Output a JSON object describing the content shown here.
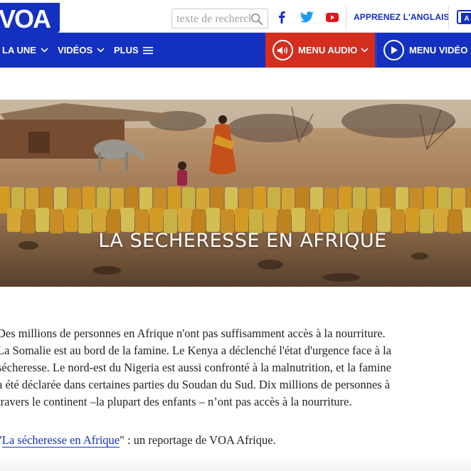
{
  "header": {
    "logo_text": "VOA",
    "search_placeholder": "texte de recherche",
    "learn_label": "APPRENEZ L'ANGLAIS"
  },
  "social": {
    "icons": [
      "facebook-icon",
      "twitter-icon",
      "youtube-icon"
    ],
    "colors": {
      "facebook": "#1330bf",
      "twitter": "#1d9bf0",
      "youtube": "#e0161b"
    }
  },
  "nav": {
    "items": [
      {
        "label": "LA UNE",
        "icon": "chevron-down-icon"
      },
      {
        "label": "VIDÉOS",
        "icon": "chevron-down-icon"
      },
      {
        "label": "PLUS",
        "icon": "hamburger-icon"
      }
    ],
    "audio_label": "MENU AUDIO",
    "video_label": "MENU VIDÉO"
  },
  "colors": {
    "brand_blue": "#1330bf",
    "audio_red": "#d32e1e"
  },
  "hero": {
    "title": "LA SECHERESSE EN AFRIQUE"
  },
  "article": {
    "lines": [
      "Des millions de personnes en Afrique n'ont pas suffisamment accès à la nourriture.",
      "La Somalie est au bord de la famine. Le Kenya a déclenché l'état d'urgence face à la",
      "sécheresse. Le nord-est du Nigeria est aussi confronté à la malnutrition, et la famine",
      "a été déclarée dans certaines parties du Soudan du Sud. Dix millions de personnes à",
      "travers le continent –la plupart des enfants – n’ont pas accès à la nourriture."
    ],
    "ref_open": "\"",
    "ref_link": "La sécheresse en Afrique",
    "ref_rest": "\" : un reportage de VOA Afrique."
  }
}
